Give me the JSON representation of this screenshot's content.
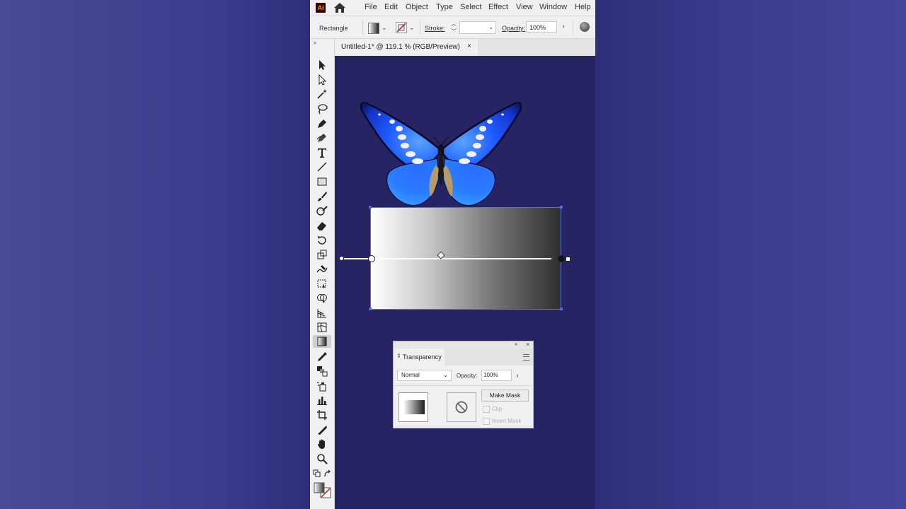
{
  "app": {
    "logo_text": "Ai",
    "menu": [
      "File",
      "Edit",
      "Object",
      "Type",
      "Select",
      "Effect",
      "View",
      "Window",
      "Help"
    ]
  },
  "control_bar": {
    "selection_type": "Rectangle",
    "stroke_label": "Stroke:",
    "stroke_value": "",
    "opacity_label": "Opacity:",
    "opacity_value": "100%"
  },
  "document": {
    "tab_title": "Untitled-1* @ 119.1 % (RGB/Preview)",
    "tab_close": "×"
  },
  "toolbar": {
    "tools": [
      "selection",
      "direct-selection",
      "magic-wand",
      "lasso",
      "pen",
      "curvature",
      "type",
      "line-segment",
      "rectangle",
      "paintbrush",
      "shaper",
      "eraser",
      "rotate",
      "scale",
      "warp",
      "free-transform",
      "shape-builder",
      "perspective-grid",
      "mesh",
      "gradient",
      "eyedropper",
      "blend",
      "symbol-sprayer",
      "column-graph",
      "artboard",
      "slice",
      "hand",
      "zoom"
    ],
    "active_tool": "gradient"
  },
  "canvas": {
    "background_color": "#262463",
    "artwork": [
      "butterfly",
      "gradient-rectangle"
    ]
  },
  "transparency_panel": {
    "title": "Transparency",
    "blend_mode": "Normal",
    "opacity_label": "Opacity:",
    "opacity_value": "100%",
    "make_mask_label": "Make Mask",
    "clip_label": "Clip",
    "invert_mask_label": "Invert Mask",
    "collapse_icon": "«",
    "close_icon": "×"
  },
  "colors": {
    "accent": "#4a6ee0",
    "ui_panel": "#f0f0f0",
    "butterfly_blue": "#1f5cff"
  }
}
